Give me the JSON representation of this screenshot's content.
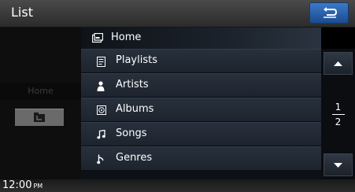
{
  "header": {
    "title": "List",
    "back_icon": "return-arrow-icon"
  },
  "left_panel": {
    "home_label": "Home",
    "folder_icon": "folder-up-icon"
  },
  "main": {
    "current_folder": {
      "label": "Home",
      "icon": "folder-icon"
    },
    "items": [
      {
        "label": "Playlists",
        "icon": "playlist-icon"
      },
      {
        "label": "Artists",
        "icon": "person-icon"
      },
      {
        "label": "Albums",
        "icon": "album-icon"
      },
      {
        "label": "Songs",
        "icon": "music-note-icon"
      },
      {
        "label": "Genres",
        "icon": "genre-icon"
      }
    ]
  },
  "pager": {
    "current": "1",
    "total": "2"
  },
  "status": {
    "time": "12:00",
    "ampm": "PM"
  },
  "colors": {
    "accent_blue": "#2a5fa8",
    "row_bg": "#232b35",
    "background": "#000000"
  }
}
